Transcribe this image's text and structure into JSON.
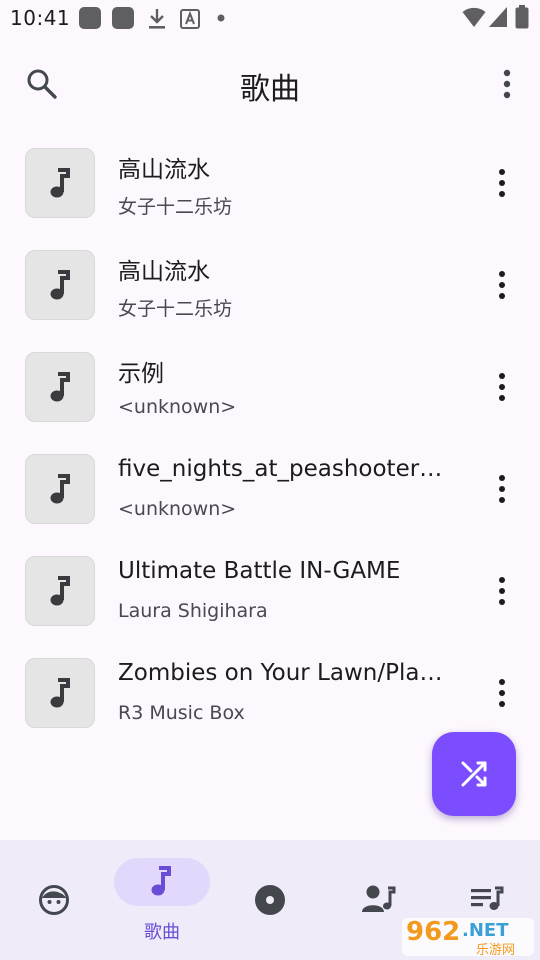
{
  "status_bar": {
    "time": "10:41",
    "left_icons": [
      "app-square-icon",
      "app-square-icon",
      "download-icon",
      "keyboard-a-icon",
      "dot-icon"
    ],
    "right_icons": [
      "wifi-icon",
      "signal-icon",
      "battery-icon"
    ]
  },
  "app_bar": {
    "title": "歌曲",
    "left_icon": "search-icon",
    "right_icon": "more-vert-icon"
  },
  "songs": [
    {
      "title": "高山流水",
      "artist": "女子十二乐坊"
    },
    {
      "title": "高山流水",
      "artist": "女子十二乐坊"
    },
    {
      "title": "示例",
      "artist": "<unknown>"
    },
    {
      "title": "five_nights_at_peashooters_…",
      "artist": "<unknown>"
    },
    {
      "title": "Ultimate Battle IN-GAME",
      "artist": "Laura Shigihara"
    },
    {
      "title": "Zombies on Your Lawn/Plant…",
      "artist": "R3 Music Box"
    }
  ],
  "fab": {
    "icon": "shuffle-icon",
    "color": "#7c4dff"
  },
  "bottom_nav": {
    "items": [
      {
        "icon": "face-icon",
        "label": ""
      },
      {
        "icon": "music-note-icon",
        "label": "歌曲",
        "selected": true
      },
      {
        "icon": "album-icon",
        "label": ""
      },
      {
        "icon": "artist-icon",
        "label": ""
      },
      {
        "icon": "playlist-icon",
        "label": ""
      }
    ]
  },
  "watermark": {
    "brand": "962.NET",
    "sub": "乐游网"
  },
  "colors": {
    "accent": "#7c4dff",
    "background": "#fdf8fd",
    "nav_background": "#f0ebf8",
    "art_background": "#e5e5e5"
  }
}
